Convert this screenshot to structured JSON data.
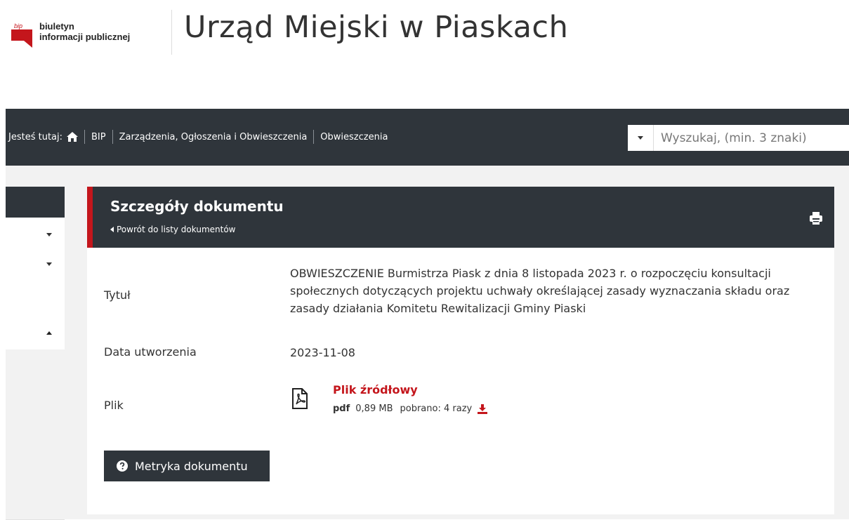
{
  "header": {
    "bip_line1": "biuletyn",
    "bip_line2": "informacji publicznej",
    "bip_badge": "bip",
    "site_title": "Urząd Miejski w Piaskach"
  },
  "breadcrumb": {
    "prefix": "Jesteś tutaj:",
    "items": [
      "BIP",
      "Zarządzenia, Ogłoszenia i Obwieszczenia",
      "Obwieszczenia"
    ]
  },
  "search": {
    "placeholder": "Wyszukaj, (min. 3 znaki)"
  },
  "document": {
    "heading": "Szczegóły dokumentu",
    "back_link": "Powrót do listy dokumentów",
    "rows": {
      "title_label": "Tytuł",
      "title_value": "OBWIESZCZENIE Burmistrza Piask z dnia 8 listopada 2023 r. o rozpoczęciu konsultacji społecznych dotyczących projektu uchwały określającej zasady wyznaczania składu oraz zasady działania Komitetu Rewitalizacji Gminy Piaski",
      "date_label": "Data utworzenia",
      "date_value": "2023-11-08",
      "file_label": "Plik"
    },
    "file": {
      "name": "Plik źródłowy",
      "ext": "pdf",
      "size": "0,89 MB",
      "downloads": "pobrano: 4 razy"
    },
    "metryka_label": "Metryka dokumentu"
  },
  "colors": {
    "dark": "#2f353b",
    "accent": "#c4161c",
    "background": "#f2f2f2"
  },
  "icons": [
    "home-icon",
    "print-icon",
    "pdf-file-icon",
    "download-icon",
    "question-circle-icon",
    "chevron-down-icon",
    "chevron-up-icon",
    "chevron-left-icon"
  ]
}
